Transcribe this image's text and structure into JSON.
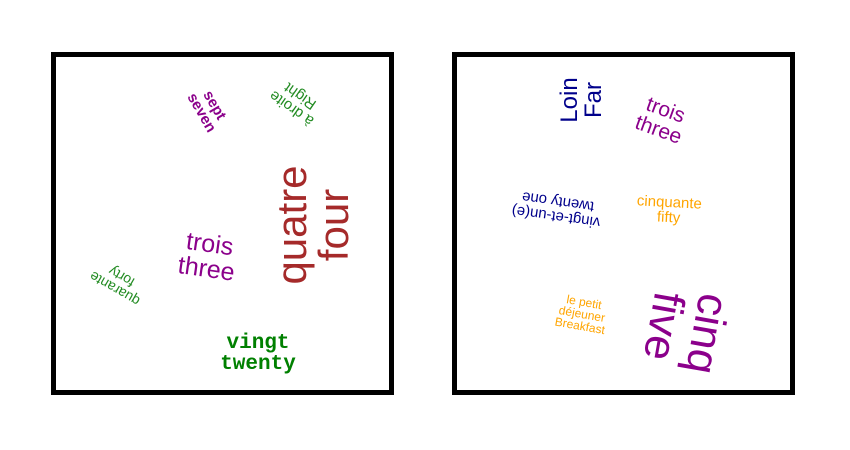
{
  "colors": {
    "purple": "#8b008b",
    "green": "#228b22",
    "darkgreen": "#008000",
    "brown": "#a52a2a",
    "navy": "#00008b",
    "orange": "#ffa500"
  },
  "left_panel": {
    "sept": {
      "fr": "sept",
      "en": "seven"
    },
    "droite": {
      "fr": "à droite",
      "en": "Right"
    },
    "quatre": {
      "fr": "quatre",
      "en": "four"
    },
    "trois": {
      "fr": "trois",
      "en": "three"
    },
    "quarante": {
      "fr": "quarante",
      "en": "forty"
    },
    "vingt": {
      "fr": "vingt",
      "en": "twenty"
    }
  },
  "right_panel": {
    "loin": {
      "fr": "Loin",
      "en": "Far"
    },
    "trois": {
      "fr": "trois",
      "en": "three"
    },
    "vingt_et_un": {
      "fr": "vingt-et-un(e)",
      "en": "twenty one"
    },
    "cinquante": {
      "fr": "cinquante",
      "en": "fifty"
    },
    "petit_dejeuner": {
      "fr1": "le petit",
      "fr2": "déjeuner",
      "en": "Breakfast"
    },
    "cinq": {
      "fr": "cinq",
      "en": "five"
    }
  }
}
